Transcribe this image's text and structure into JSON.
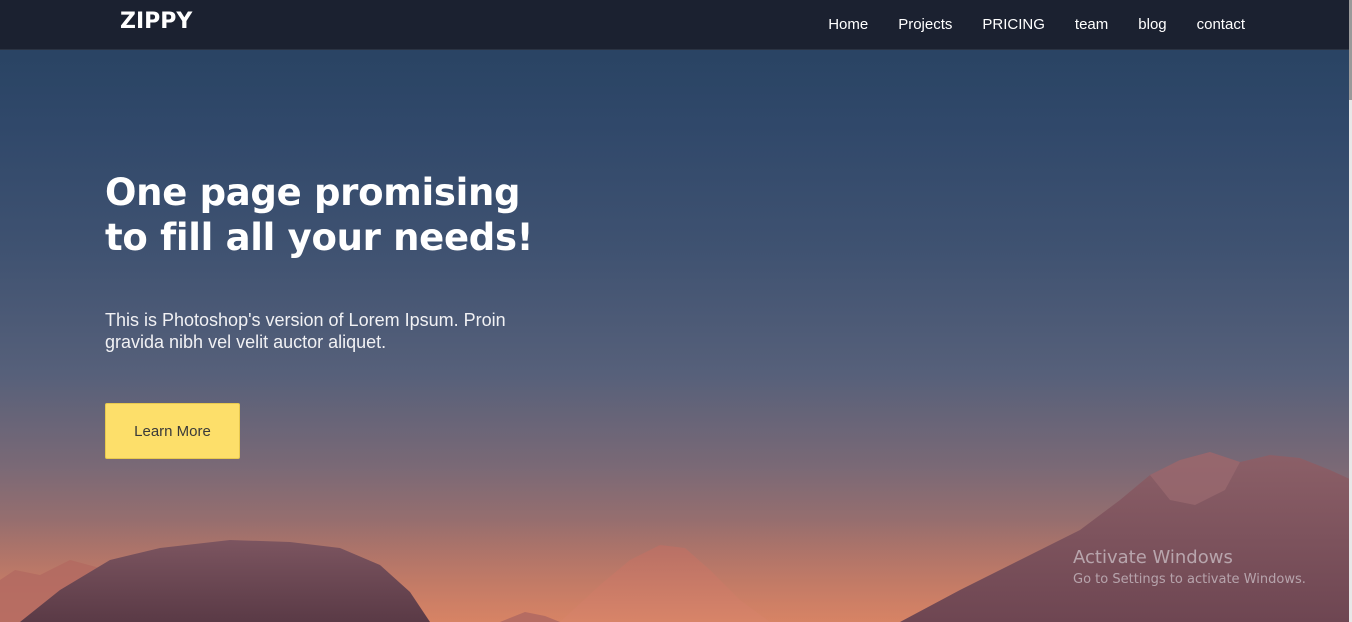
{
  "brand": {
    "logo_text": "ZIPPY"
  },
  "nav": {
    "items": [
      {
        "label": "Home"
      },
      {
        "label": "Projects"
      },
      {
        "label": "PRICING"
      },
      {
        "label": "team"
      },
      {
        "label": "blog"
      },
      {
        "label": "contact"
      }
    ]
  },
  "hero": {
    "title_line1": "One page promising",
    "title_line2": "to fill all your needs!",
    "subtitle_line1": "This is Photoshop's version of Lorem Ipsum. Proin",
    "subtitle_line2": "gravida nibh vel velit auctor aliquet.",
    "cta_label": "Learn More"
  },
  "watermark": {
    "title": "Activate Windows",
    "subtitle": "Go to Settings to activate Windows."
  },
  "colors": {
    "navbar_bg": "#1b2130",
    "cta_bg": "#fddf6a",
    "hero_top": "#25415f",
    "hero_bottom": "#c97a63"
  }
}
